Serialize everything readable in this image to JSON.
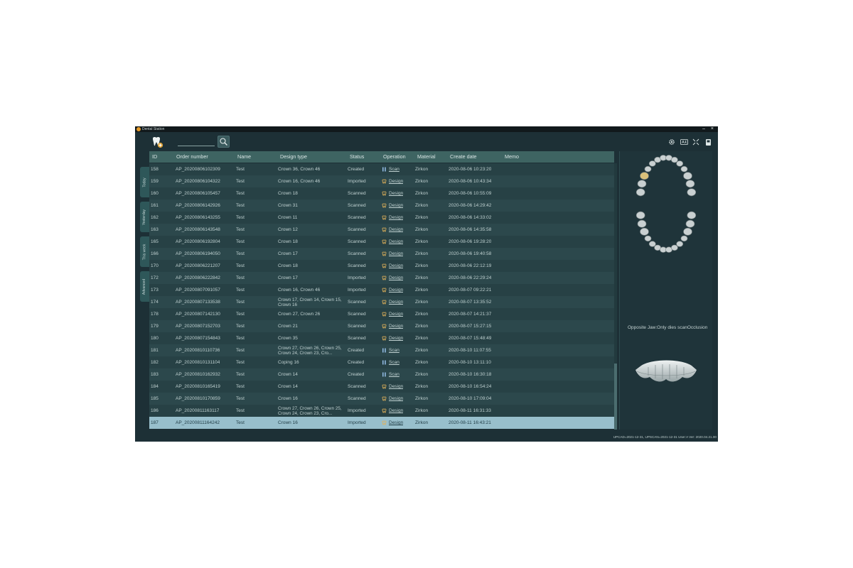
{
  "window": {
    "title": "Dental Station",
    "minimize": "–",
    "close": "×"
  },
  "search": {
    "value": "",
    "placeholder": ""
  },
  "toolbar": {
    "icons": [
      "settings-icon",
      "language-icon",
      "fullscreen-icon",
      "device-icon"
    ]
  },
  "side_tabs": [
    "Today",
    "Yesterday",
    "This week",
    "Advanced"
  ],
  "table": {
    "columns": [
      "ID",
      "Order number",
      "Name",
      "Design type",
      "Status",
      "Operation",
      "Material",
      "Create date",
      "Memo"
    ],
    "rows": [
      {
        "id": "158",
        "order": "AP_20200806102309",
        "name": "Test",
        "design": "Crown 36, Crown 46",
        "status": "Created",
        "op": "Scan",
        "material": "Zirkon",
        "date": "2020-08-06 10:23:20"
      },
      {
        "id": "159",
        "order": "AP_20200806104322",
        "name": "Test",
        "design": "Crown 16, Crown 46",
        "status": "Imported",
        "op": "Design",
        "material": "Zirkon",
        "date": "2020-08-06 10:43:34"
      },
      {
        "id": "160",
        "order": "AP_20200806105457",
        "name": "Test",
        "design": "Crown 18",
        "status": "Scanned",
        "op": "Design",
        "material": "Zirkon",
        "date": "2020-08-06 10:55:09"
      },
      {
        "id": "161",
        "order": "AP_20200806142926",
        "name": "Test",
        "design": "Crown 31",
        "status": "Scanned",
        "op": "Design",
        "material": "Zirkon",
        "date": "2020-08-06 14:29:42"
      },
      {
        "id": "162",
        "order": "AP_20200806143255",
        "name": "Test",
        "design": "Crown 11",
        "status": "Scanned",
        "op": "Design",
        "material": "Zirkon",
        "date": "2020-08-06 14:33:02"
      },
      {
        "id": "163",
        "order": "AP_20200806143548",
        "name": "Test",
        "design": "Crown 12",
        "status": "Scanned",
        "op": "Design",
        "material": "Zirkon",
        "date": "2020-08-06 14:35:58"
      },
      {
        "id": "165",
        "order": "AP_20200806192804",
        "name": "Test",
        "design": "Crown 18",
        "status": "Scanned",
        "op": "Design",
        "material": "Zirkon",
        "date": "2020-08-06 19:28:20"
      },
      {
        "id": "166",
        "order": "AP_20200806194050",
        "name": "Test",
        "design": "Crown 17",
        "status": "Scanned",
        "op": "Design",
        "material": "Zirkon",
        "date": "2020-08-06 19:40:58"
      },
      {
        "id": "170",
        "order": "AP_20200806221207",
        "name": "Test",
        "design": "Crown 18",
        "status": "Scanned",
        "op": "Design",
        "material": "Zirkon",
        "date": "2020-08-06 22:12:19"
      },
      {
        "id": "172",
        "order": "AP_20200806222842",
        "name": "Test",
        "design": "Crown 17",
        "status": "Imported",
        "op": "Design",
        "material": "Zirkon",
        "date": "2020-08-06 22:29:24"
      },
      {
        "id": "173",
        "order": "AP_20200807091057",
        "name": "Test",
        "design": "Crown 16, Crown 46",
        "status": "Imported",
        "op": "Design",
        "material": "Zirkon",
        "date": "2020-08-07 09:22:21"
      },
      {
        "id": "174",
        "order": "AP_20200807133538",
        "name": "Test",
        "design": "Crown 17, Crown 14, Crown 15, Crown 16",
        "status": "Scanned",
        "op": "Design",
        "material": "Zirkon",
        "date": "2020-08-07 13:35:52",
        "wrap": true
      },
      {
        "id": "178",
        "order": "AP_20200807142130",
        "name": "Test",
        "design": "Crown 27, Crown 26",
        "status": "Scanned",
        "op": "Design",
        "material": "Zirkon",
        "date": "2020-08-07 14:21:37"
      },
      {
        "id": "179",
        "order": "AP_20200807152703",
        "name": "Test",
        "design": "Crown 21",
        "status": "Scanned",
        "op": "Design",
        "material": "Zirkon",
        "date": "2020-08-07 15:27:15"
      },
      {
        "id": "180",
        "order": "AP_20200807154843",
        "name": "Test",
        "design": "Crown 35",
        "status": "Scanned",
        "op": "Design",
        "material": "Zirkon",
        "date": "2020-08-07 15:48:49"
      },
      {
        "id": "181",
        "order": "AP_20200810110736",
        "name": "Test",
        "design": "Crown 27, Crown 26, Crown 25, Crown 24, Crown 23, Cro...",
        "status": "Created",
        "op": "Scan",
        "material": "Zirkon",
        "date": "2020-08-10 11:07:55",
        "wrap": true
      },
      {
        "id": "182",
        "order": "AP_20200810131104",
        "name": "Test",
        "design": "Coping 16",
        "status": "Created",
        "op": "Scan",
        "material": "Zirkon",
        "date": "2020-08-10 13:11:10"
      },
      {
        "id": "183",
        "order": "AP_20200810162932",
        "name": "Test",
        "design": "Crown 14",
        "status": "Created",
        "op": "Scan",
        "material": "Zirkon",
        "date": "2020-08-10 16:30:18"
      },
      {
        "id": "184",
        "order": "AP_20200810165419",
        "name": "Test",
        "design": "Crown 14",
        "status": "Scanned",
        "op": "Design",
        "material": "Zirkon",
        "date": "2020-08-10 16:54:24"
      },
      {
        "id": "185",
        "order": "AP_20200810170859",
        "name": "Test",
        "design": "Crown 16",
        "status": "Scanned",
        "op": "Design",
        "material": "Zirkon",
        "date": "2020-08-10 17:09:04"
      },
      {
        "id": "186",
        "order": "AP_20200811163117",
        "name": "Test",
        "design": "Crown 27, Crown 26, Crown 25, Crown 24, Crown 23, Cro...",
        "status": "Imported",
        "op": "Design",
        "material": "Zirkon",
        "date": "2020-08-11 16:31:33",
        "wrap": true
      },
      {
        "id": "187",
        "order": "AP_20200811164242",
        "name": "Test",
        "design": "Crown 16",
        "status": "Imported",
        "op": "Design",
        "material": "Zirkon",
        "date": "2020-08-11 16:43:21",
        "selected": true
      }
    ]
  },
  "right_panel": {
    "note": "Opposite Jaw:Only dies scanOcclusion",
    "highlighted_tooth": "16"
  },
  "status_bar": "UPCAD=2021-12-31, UPSCAN=2021-12-31   User:A   Ver: 2020.04.21.00",
  "colors": {
    "accent": "#3e6462",
    "selected_row": "#98bfcc",
    "tooth_highlight": "#d9c07a",
    "design_icon": "#e2b25a",
    "scan_icon": "#8fb8e0"
  }
}
